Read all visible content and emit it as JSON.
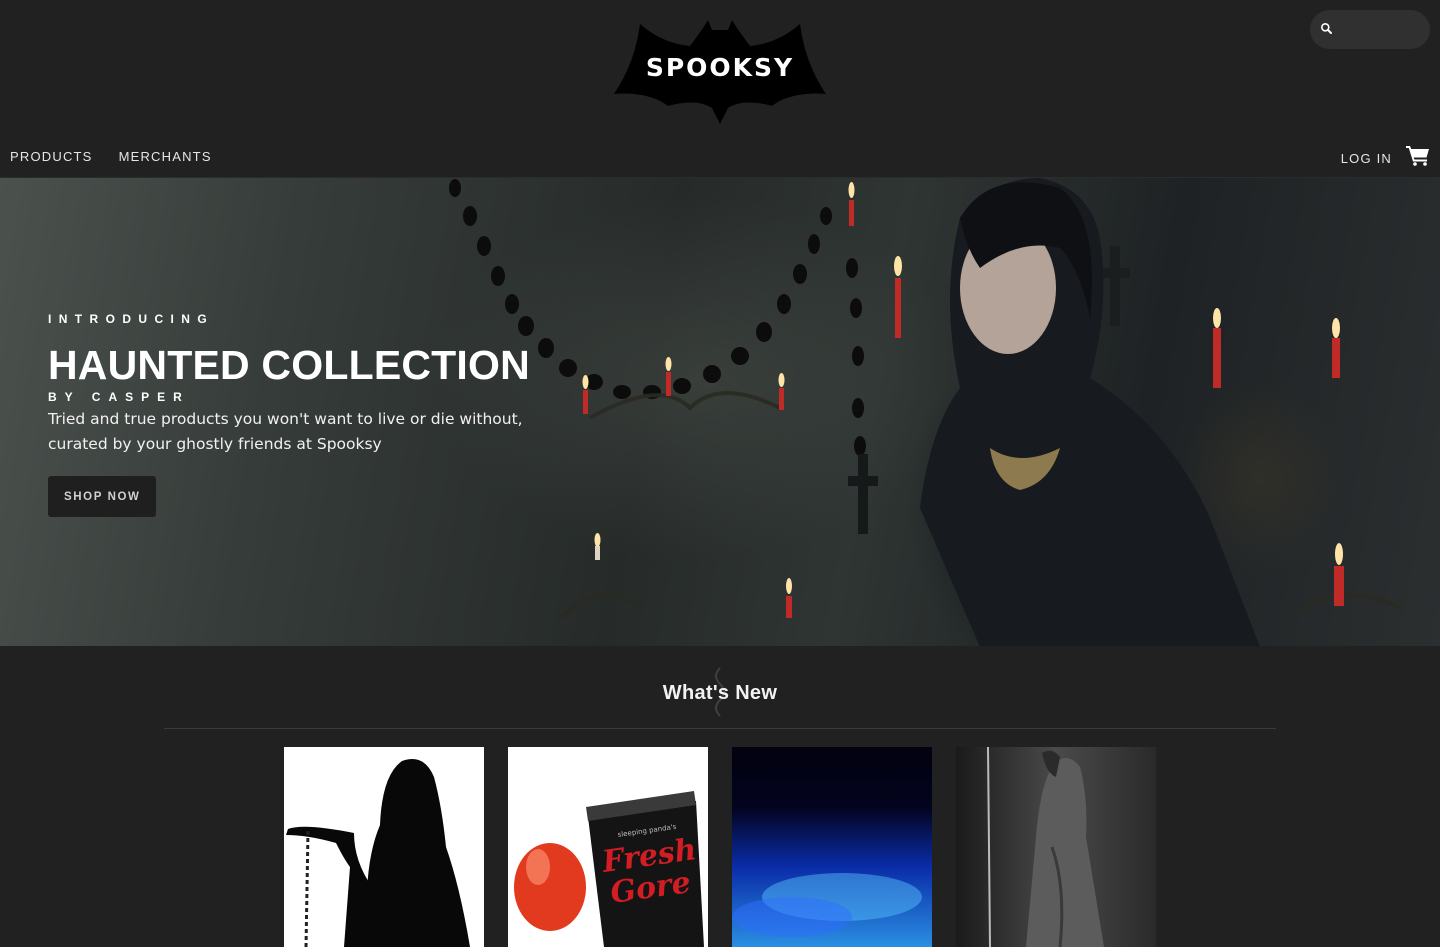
{
  "header": {
    "logo_text": "SPOOKSY",
    "search": {
      "placeholder": "",
      "value": ""
    },
    "nav": {
      "products": "PRODUCTS",
      "merchants": "MERCHANTS"
    },
    "login": "LOG IN",
    "icons": {
      "search": "search-icon",
      "cart": "cart-icon",
      "logo": "bat-logo"
    }
  },
  "hero": {
    "eyebrow": "INTRODUCING",
    "title": "HAUNTED COLLECTION",
    "byline": "BY CASPER",
    "description": "Tried and true products you won't want to live or die without, curated by your ghostly friends at Spooksy",
    "button": "SHOP NOW"
  },
  "whats_new": {
    "title": "What's New",
    "products": [
      {
        "image": "hooded-reaper-silhouette"
      },
      {
        "image": "fresh-gore-blood-tube",
        "label_line1": "sleeping panda's",
        "label_line2": "Fresh",
        "label_line3": "Gore"
      },
      {
        "image": "blue-smoke-fog"
      },
      {
        "image": "ghostly-figure-bw"
      }
    ]
  },
  "colors": {
    "background": "#212121",
    "search_bg": "#303030",
    "text": "#ededed",
    "button_bg": "#1f1f1f"
  }
}
